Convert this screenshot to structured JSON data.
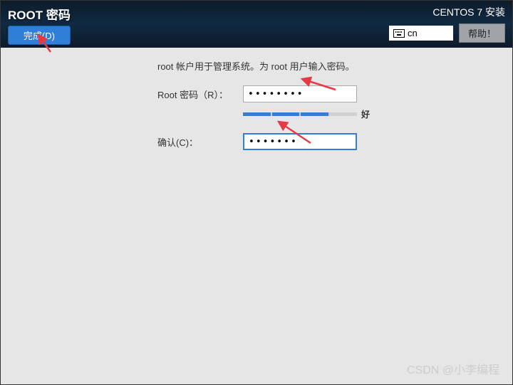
{
  "header": {
    "page_title": "ROOT 密码",
    "done_label": "完成(D)",
    "install_title": "CENTOS 7 安装",
    "lang_code": "cn",
    "help_label": "帮助！"
  },
  "form": {
    "description": "root 帐户用于管理系统。为 root 用户输入密码。",
    "password_label": "Root 密码（R）：",
    "password_value": "••••••••",
    "confirm_label": "确认(C)：",
    "confirm_value": "•••••••",
    "strength_text": "好"
  },
  "watermark": "CSDN @小李编程"
}
